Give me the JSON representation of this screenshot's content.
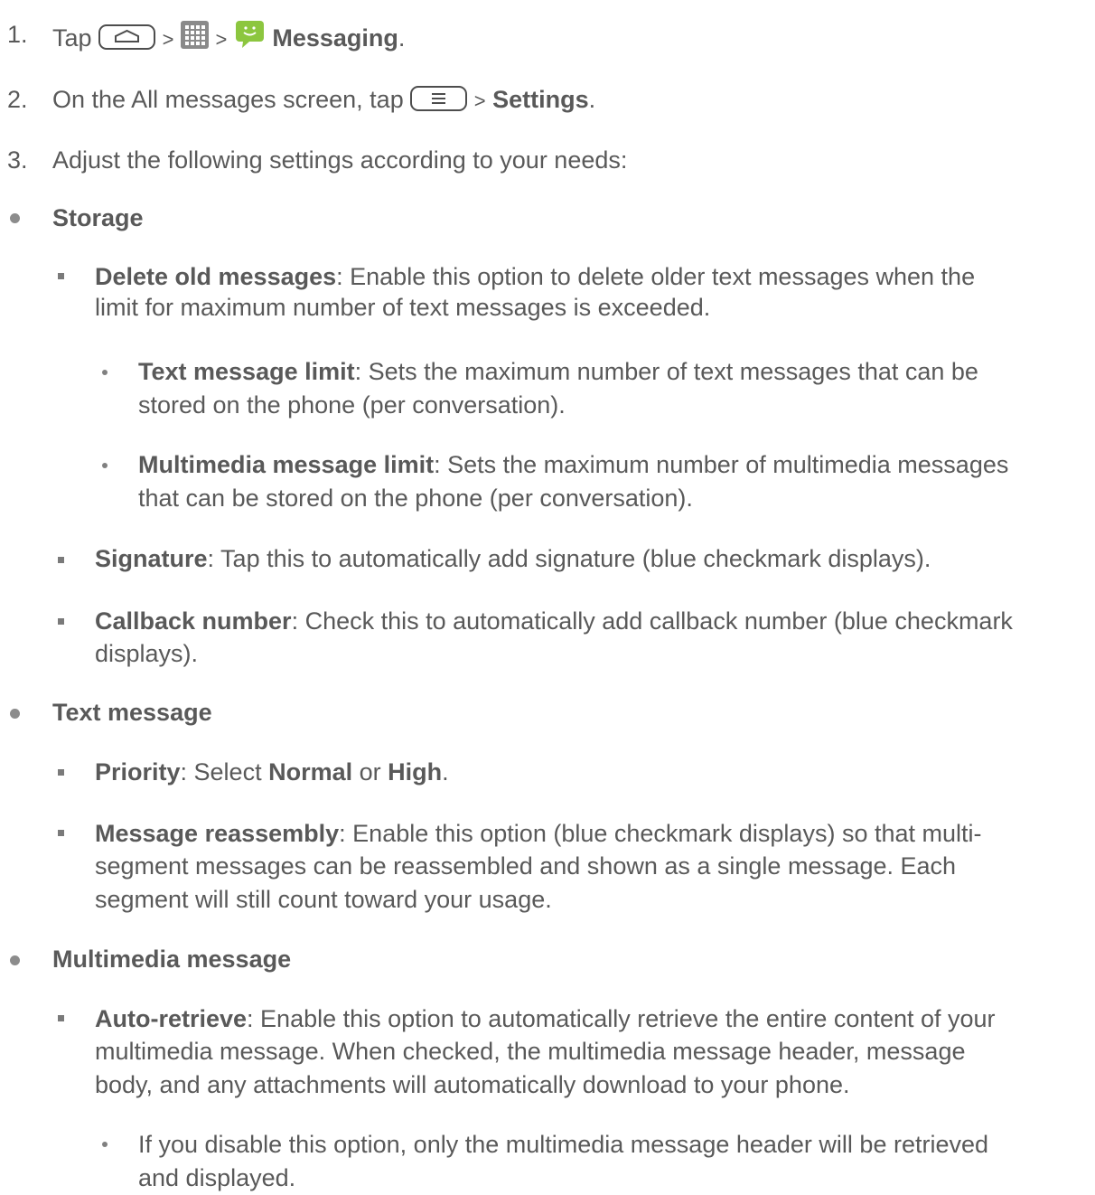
{
  "steps": [
    {
      "num": "1.",
      "pre": "Tap",
      "gt1": ">",
      "gt2": ">",
      "app": "Messaging",
      "end": "."
    },
    {
      "num": "2.",
      "pre": "On the All messages screen, tap",
      "gt": ">",
      "bold": "Settings",
      "end": "."
    },
    {
      "num": "3.",
      "text": "Adjust the following settings according to your needs:"
    }
  ],
  "sections": [
    {
      "title": "Storage",
      "items": [
        {
          "term": "Delete old messages",
          "desc_l1": ": Enable this option to delete older text messages when the",
          "desc_l2": "limit for maximum number of text messages is exceeded.",
          "subitems": [
            {
              "term": "Text message limit",
              "desc_l1": ": Sets the maximum number of text messages that can be",
              "desc_l2": "stored on the phone (per conversation)."
            },
            {
              "term": "Multimedia message limit",
              "desc_l1": ": Sets the maximum number of multimedia messages",
              "desc_l2": "that can be stored on the phone (per conversation)."
            }
          ]
        },
        {
          "term": "Signature",
          "desc_l1": ": Tap this to automatically add signature (blue checkmark displays)."
        },
        {
          "term": "Callback number",
          "desc_l1": ": Check this to automatically add callback number (blue checkmark",
          "desc_l2": "displays)."
        }
      ]
    },
    {
      "title": "Text message",
      "items": [
        {
          "term": "Priority",
          "p1": ": Select ",
          "normal": "Normal",
          "p2": " or ",
          "high": "High",
          "p3": "."
        },
        {
          "term": "Message reassembly",
          "desc_l1": ": Enable this option (blue checkmark displays) so that multi-",
          "desc_l2": "segment messages can be reassembled and shown as a single message. Each",
          "desc_l3": "segment will still count toward your usage."
        }
      ]
    },
    {
      "title": "Multimedia message",
      "items": [
        {
          "term": "Auto-retrieve",
          "desc_l1": ": Enable this option to automatically retrieve the entire content of your",
          "desc_l2": "multimedia message. When checked, the multimedia message header, message",
          "desc_l3": "body, and any attachments will automatically download to your phone.",
          "subitems": [
            {
              "text_l1": "If you disable this option, only the multimedia message header will be retrieved",
              "text_l2": "and displayed."
            }
          ]
        }
      ]
    }
  ],
  "icons": {
    "home": "home-key-icon",
    "apps": "apps-grid-icon",
    "messaging": "messaging-app-icon",
    "menu": "menu-key-icon"
  },
  "colors": {
    "text": "#595959",
    "icon_green": "#8cc63f"
  }
}
